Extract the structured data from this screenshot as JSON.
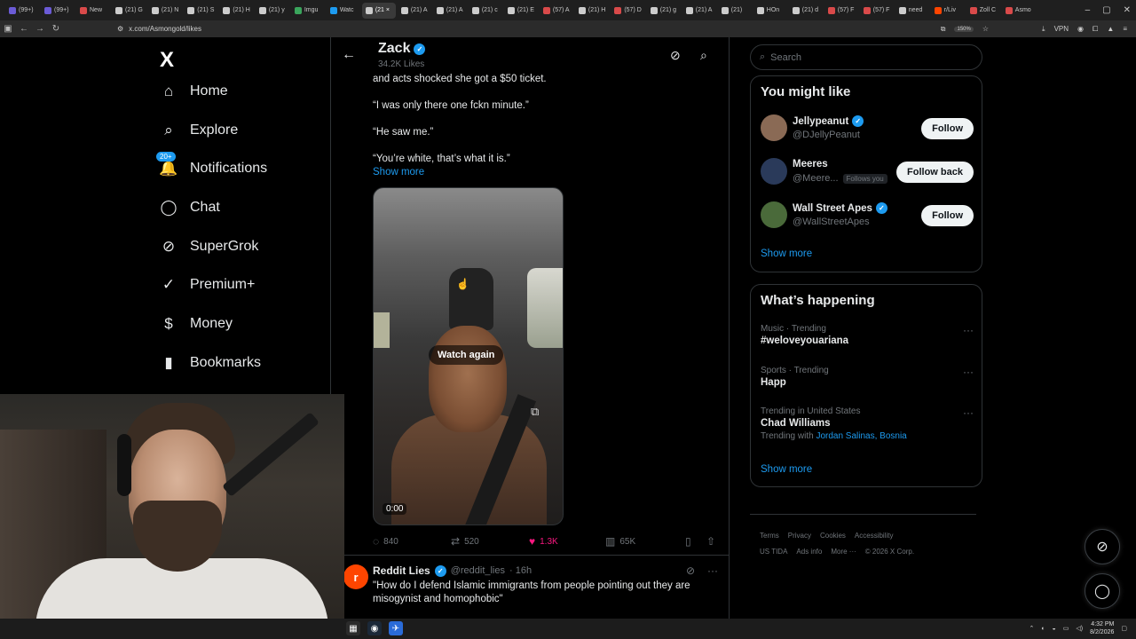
{
  "browser": {
    "tabs": [
      {
        "label": "(99+)",
        "color": "#6b5bd6"
      },
      {
        "label": "(99+)",
        "color": "#6b5bd6"
      },
      {
        "label": "New",
        "color": "#d94a4a"
      },
      {
        "label": "(21) G",
        "color": "#cccccc"
      },
      {
        "label": "(21) N",
        "color": "#cccccc"
      },
      {
        "label": "(21) S",
        "color": "#cccccc"
      },
      {
        "label": "(21) H",
        "color": "#cccccc"
      },
      {
        "label": "(21) y",
        "color": "#cccccc"
      },
      {
        "label": "Imgu",
        "color": "#3aa55c"
      },
      {
        "label": "Watc",
        "color": "#1d9bf0"
      },
      {
        "label": "(21 ×",
        "color": "#cccccc",
        "active": true
      },
      {
        "label": "(21) A",
        "color": "#cccccc"
      },
      {
        "label": "(21) A",
        "color": "#cccccc"
      },
      {
        "label": "(21) c",
        "color": "#cccccc"
      },
      {
        "label": "(21) E",
        "color": "#cccccc"
      },
      {
        "label": "(57) A",
        "color": "#d94a4a"
      },
      {
        "label": "(21) H",
        "color": "#cccccc"
      },
      {
        "label": "(57) D",
        "color": "#d94a4a"
      },
      {
        "label": "(21) g",
        "color": "#cccccc"
      },
      {
        "label": "(21) A",
        "color": "#cccccc"
      },
      {
        "label": "(21)",
        "color": "#cccccc"
      },
      {
        "label": "HOn",
        "color": "#cccccc"
      },
      {
        "label": "(21) d",
        "color": "#cccccc"
      },
      {
        "label": "(57) F",
        "color": "#d94a4a"
      },
      {
        "label": "(57) F",
        "color": "#d94a4a"
      },
      {
        "label": "need",
        "color": "#cccccc"
      },
      {
        "label": "r/Liv",
        "color": "#ff4500"
      },
      {
        "label": "Zoll C",
        "color": "#d94a4a"
      },
      {
        "label": "Asmo",
        "color": "#d94a4a"
      }
    ],
    "url": "x.com/Asmongold/likes",
    "zoom": "150%",
    "vpn": "VPN"
  },
  "nav": {
    "logo": "X",
    "items": [
      {
        "label": "Home",
        "icon": "home-icon",
        "glyph": "⌂"
      },
      {
        "label": "Explore",
        "icon": "search-icon",
        "glyph": "⌕"
      },
      {
        "label": "Notifications",
        "icon": "bell-icon",
        "glyph": "🔔",
        "badge": "20+"
      },
      {
        "label": "Chat",
        "icon": "chat-icon",
        "glyph": "◯"
      },
      {
        "label": "SuperGrok",
        "icon": "grok-icon",
        "glyph": "⊘"
      },
      {
        "label": "Premium+",
        "icon": "premium-icon",
        "glyph": "✓"
      },
      {
        "label": "Money",
        "icon": "money-icon",
        "glyph": "$"
      },
      {
        "label": "Bookmarks",
        "icon": "bookmark-icon",
        "glyph": "▮"
      }
    ]
  },
  "header": {
    "name": "Zack",
    "likes": "34.2K Likes"
  },
  "post": {
    "lines": [
      "and acts shocked she got a $50 ticket.",
      "“I was only there one fckn minute.”",
      "“He saw me.”",
      "“You’re white, that’s what it is.”"
    ],
    "show_more": "Show more",
    "video": {
      "watch_again": "Watch again",
      "timecode": "0:00"
    },
    "actions": {
      "replies": "840",
      "reposts": "520",
      "likes": "1.3K",
      "views": "65K"
    }
  },
  "next_post": {
    "avatar_letter": "r",
    "name": "Reddit Lies",
    "handle": "@reddit_lies",
    "time": "· 16h",
    "text": "\"How do I defend Islamic immigrants from people pointing out they are misogynist and homophobic\""
  },
  "right": {
    "search_placeholder": "Search",
    "wtf_title": "You might like",
    "suggestions": [
      {
        "name": "Jellypeanut",
        "handle": "@DJellyPeanut",
        "button": "Follow",
        "verified": true,
        "avatar_color": "#8a6a55"
      },
      {
        "name": "Meeres",
        "handle": "@Meere...",
        "follows_you": "Follows you",
        "button": "Follow back",
        "verified": false,
        "avatar_color": "#2a3a5a"
      },
      {
        "name": "Wall Street Apes",
        "handle": "@WallStreetApes",
        "button": "Follow",
        "verified": true,
        "avatar_color": "#4a6a3a"
      }
    ],
    "wtf_show_more": "Show more",
    "trends_title": "What’s happening",
    "trends": [
      {
        "category": "Music · Trending",
        "name": "#weloveyouariana"
      },
      {
        "category": "Sports · Trending",
        "name": "Happ"
      },
      {
        "category": "Trending in United States",
        "name": "Chad Williams",
        "with_label": "Trending with",
        "with_links": "Jordan Salinas, Bosnia"
      }
    ],
    "trends_show_more": "Show more",
    "footer": [
      "Terms",
      "Privacy",
      "Cookies",
      "Accessibility",
      "US TIDA",
      "Ads info",
      "More ···",
      "© 2026 X Corp."
    ]
  },
  "taskbar": {
    "time": "4:32 PM",
    "date": "8/2/2026"
  },
  "colors": {
    "accent": "#1d9bf0",
    "like": "#f91880"
  }
}
